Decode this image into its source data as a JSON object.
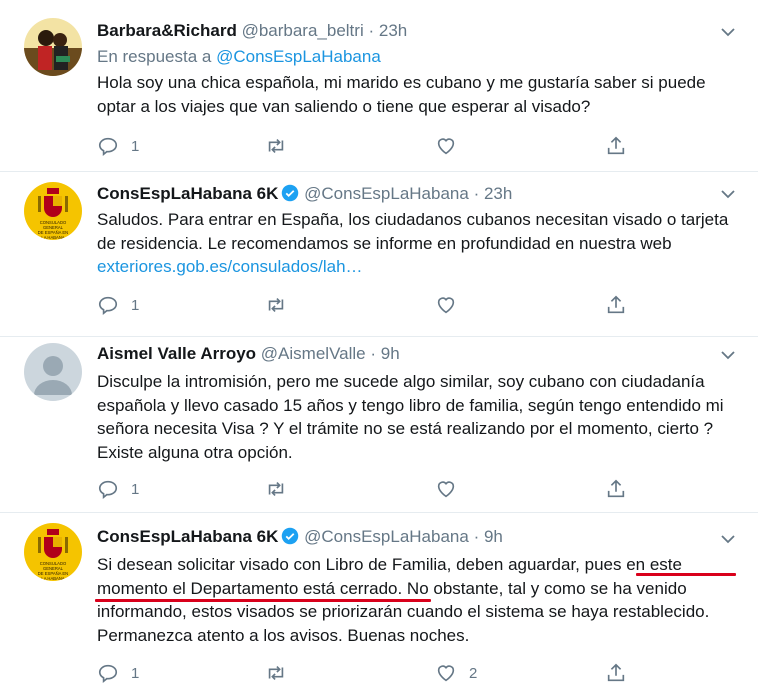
{
  "tweets": [
    {
      "name": "Barbara&Richard",
      "handle": "@barbara_beltri",
      "sep": "·",
      "time": "23h",
      "reply_prefix": "En respuesta a ",
      "reply_to": "@ConsEspLaHabana",
      "text": "Hola soy una chica española, mi marido es cubano y me gustaría saber si puede optar a los viajes que van saliendo o tiene que esperar al visado?",
      "reply_count": "1",
      "retweet_count": "",
      "like_count": ""
    },
    {
      "name": "ConsEspLaHabana 6K",
      "handle": "@ConsEspLaHabana",
      "sep": "·",
      "time": "23h",
      "text": "Saludos. Para entrar en España, los ciudadanos cubanos necesitan visado o tarjeta de residencia. Le recomendamos se informe en profundidad en nuestra web ",
      "link": "exteriores.gob.es/consulados/lah…",
      "reply_count": "1",
      "retweet_count": "",
      "like_count": ""
    },
    {
      "name": "Aismel Valle Arroyo",
      "handle": "@AismelValle",
      "sep": "·",
      "time": "9h",
      "text": "Disculpe la intromisión, pero me sucede algo similar, soy cubano con ciudadanía española y llevo casado 15 años y tengo libro de familia, según tengo entendido mi señora necesita Visa ? Y el trámite no se está realizando por el momento, cierto ? Existe alguna otra opción.",
      "reply_count": "1",
      "retweet_count": "",
      "like_count": ""
    },
    {
      "name": "ConsEspLaHabana 6K",
      "handle": "@ConsEspLaHabana",
      "sep": "·",
      "time": "9h",
      "text": "Si desean solicitar visado con Libro de Familia, deben aguardar, pues en este momento el Departamento está cerrado. No obstante, tal y como se ha venido informando, estos visados se priorizarán cuando el sistema se haya restablecido. Permanezca atento a los avisos. Buenas noches.",
      "reply_count": "1",
      "retweet_count": "",
      "like_count": "2"
    }
  ],
  "seal_text": "CONSULADO GENERAL DE ESPAÑA EN LA HABANA",
  "colors": {
    "accent": "#1b95e0",
    "secondary": "#657786",
    "seal_bg": "#f5c400",
    "underline": "#d9001b"
  }
}
